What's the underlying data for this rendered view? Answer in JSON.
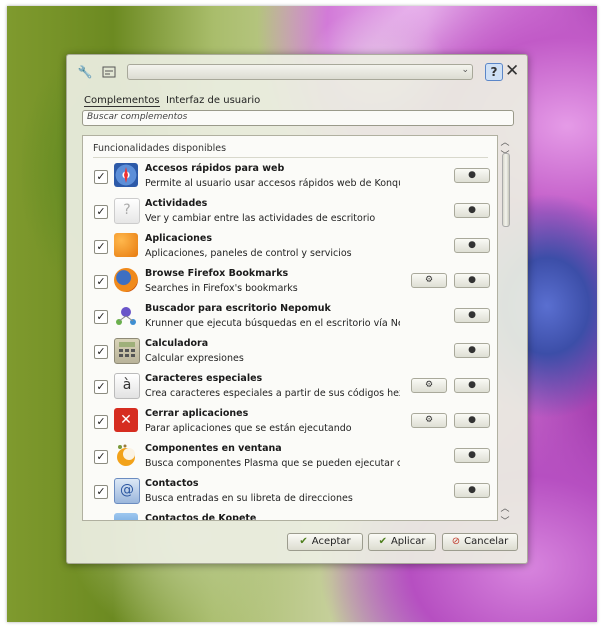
{
  "dialog": {
    "combo_value": "",
    "help_label": "?",
    "close_label": "✕",
    "tabs": [
      {
        "label": "Complementos",
        "active": true
      },
      {
        "label": "Interfaz de usuario",
        "active": false
      }
    ],
    "search_placeholder": "Buscar complementos",
    "list_header": "Funcionalidades disponibles",
    "plugins": [
      {
        "name": "Accesos rápidos para web",
        "desc": "Permite al usuario usar accesos rápidos web de Konqueror",
        "checked": true,
        "configurable": false,
        "icon": "compass-icon"
      },
      {
        "name": "Actividades",
        "desc": "Ver y cambiar entre las actividades de escritorio",
        "checked": true,
        "configurable": false,
        "icon": "unknown-icon"
      },
      {
        "name": "Aplicaciones",
        "desc": "Aplicaciones, paneles de control y servicios",
        "checked": true,
        "configurable": false,
        "icon": "applications-icon"
      },
      {
        "name": "Browse Firefox Bookmarks",
        "desc": "Searches in Firefox's bookmarks",
        "checked": true,
        "configurable": true,
        "icon": "firefox-icon"
      },
      {
        "name": "Buscador para escritorio Nepomuk",
        "desc": "Krunner que ejecuta búsquedas en el escritorio vía Nepomuk",
        "checked": true,
        "configurable": false,
        "icon": "nepomuk-icon"
      },
      {
        "name": "Calculadora",
        "desc": "Calcular expresiones",
        "checked": true,
        "configurable": false,
        "icon": "calculator-icon"
      },
      {
        "name": "Caracteres especiales",
        "desc": "Crea caracteres especiales a partir de sus códigos hex...",
        "checked": true,
        "configurable": true,
        "icon": "special-chars-icon"
      },
      {
        "name": "Cerrar aplicaciones",
        "desc": "Parar aplicaciones que se están ejecutando",
        "checked": true,
        "configurable": true,
        "icon": "kill-app-icon"
      },
      {
        "name": "Componentes en ventana",
        "desc": "Busca componentes Plasma que se pueden ejecutar como venta...",
        "checked": true,
        "configurable": false,
        "icon": "plasma-icon"
      },
      {
        "name": "Contactos",
        "desc": "Busca entradas en su libreta de direcciones",
        "checked": true,
        "configurable": false,
        "icon": "contacts-icon"
      },
      {
        "name": "Contactos de Kopete",
        "desc": "",
        "checked": true,
        "configurable": false,
        "icon": "kopete-icon"
      }
    ],
    "buttons": {
      "accept": "Aceptar",
      "apply": "Aplicar",
      "cancel": "Cancelar"
    },
    "colors": {
      "accent": "#5b86c8",
      "ok_icon": "#4e7f1d",
      "cancel_icon": "#c0392b"
    }
  }
}
